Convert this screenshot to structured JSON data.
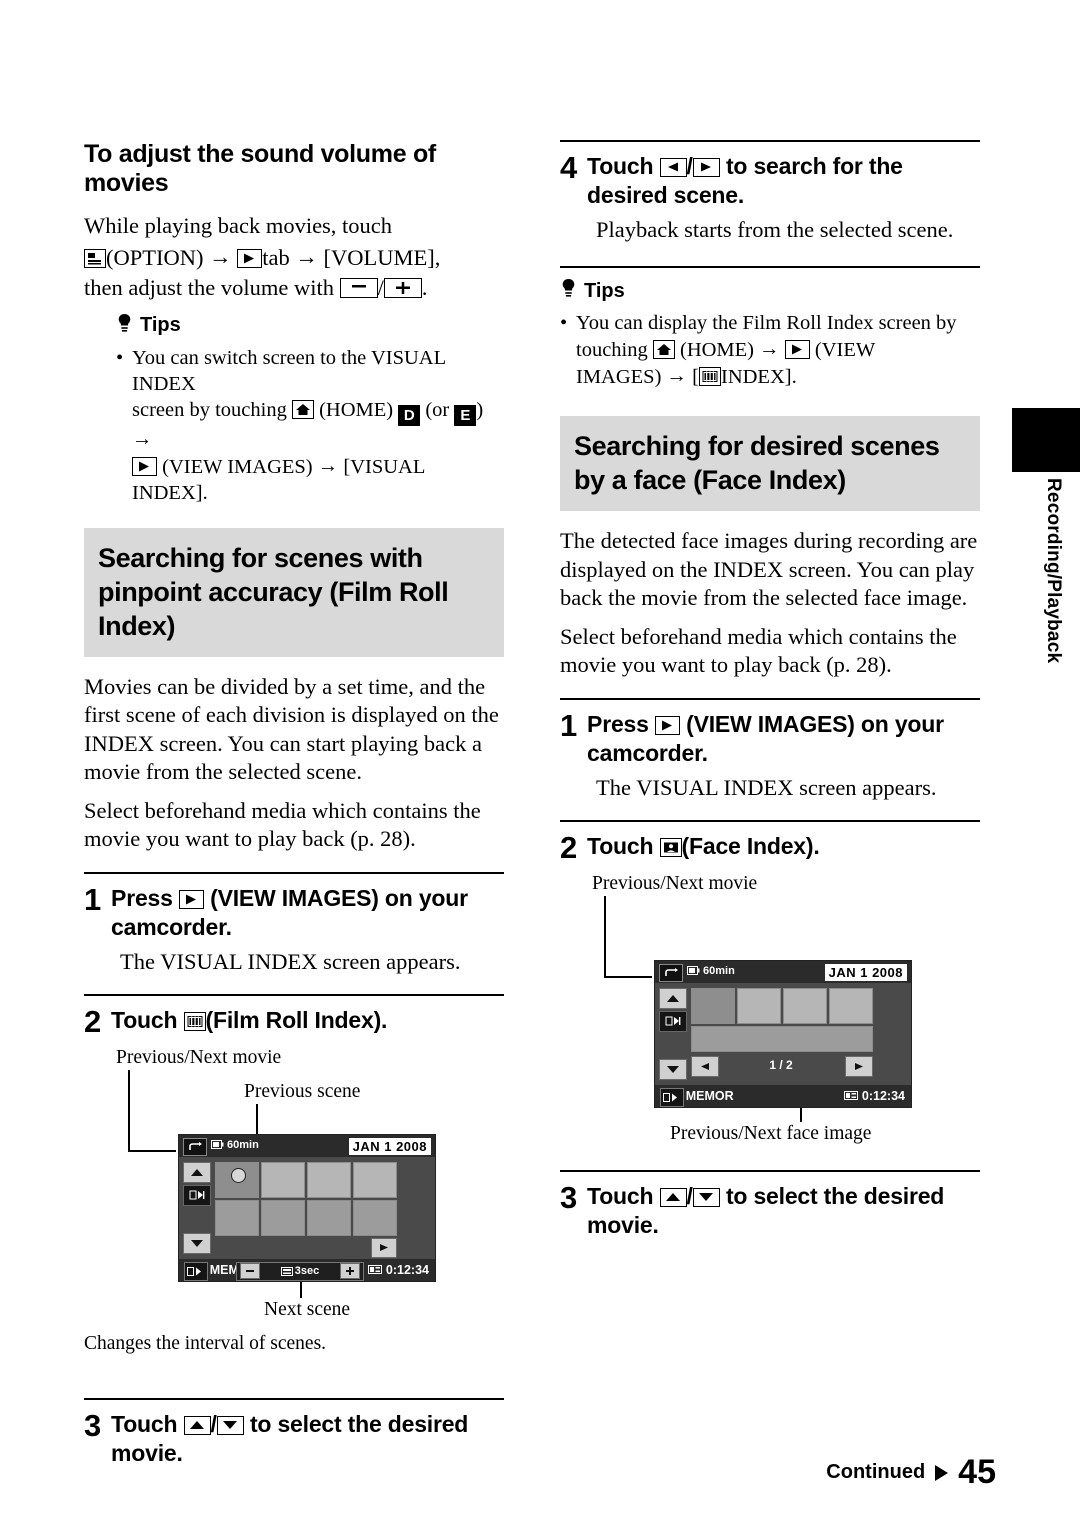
{
  "page": {
    "number": "45",
    "continued": "Continued",
    "side_tab": "Recording/Playback"
  },
  "left": {
    "volume": {
      "title": "To adjust the sound volume of movies",
      "line1": "While playing back movies, touch",
      "line2_pre": "(OPTION)",
      "line2_tab": "tab",
      "line2_volume": "[VOLUME],",
      "line3_pre": "then adjust the volume with",
      "line3_post": ".",
      "tips_label": "Tips",
      "tip1_a": "You can switch screen to the VISUAL INDEX",
      "tip1_b": "screen by touching",
      "tip1_home": "(HOME)",
      "tip1_d": "D",
      "tip1_or": "(or",
      "tip1_e": "E",
      "tip1_close": ")",
      "tip1_c": "(VIEW IMAGES)",
      "tip1_d2": "[VISUAL INDEX]."
    },
    "filmroll": {
      "heading": "Searching for scenes with pinpoint accuracy (Film Roll Index)",
      "intro": "Movies can be divided by a set time, and the first scene of each division is displayed on the INDEX screen. You can start playing back a movie from the selected scene.",
      "intro2": "Select beforehand media which contains the movie you want to play back (p. 28).",
      "step1_num": "1",
      "step1_a": "Press",
      "step1_b": "(VIEW IMAGES) on your camcorder.",
      "step1_body": "The VISUAL INDEX screen appears.",
      "step2_num": "2",
      "step2_a": "Touch",
      "step2_b": "(Film Roll Index).",
      "callout_prevnext": "Previous/Next movie",
      "callout_prevscene": "Previous scene",
      "callout_nextscene": "Next scene",
      "callout_interval": "Changes the interval of scenes.",
      "step3_num": "3",
      "step3_a": "Touch",
      "step3_b": "to select the desired movie.",
      "lcd": {
        "battery": "60min",
        "date": "JAN  1  2008",
        "memory": "INT. MEMORY",
        "timecode": "0:12:34",
        "interval": "3sec"
      }
    }
  },
  "right": {
    "step4": {
      "num": "4",
      "a": "Touch",
      "b": "to search for the desired scene.",
      "body": "Playback starts from the selected scene.",
      "tips_label": "Tips",
      "tip1_a": "You can display the Film Roll Index screen by",
      "tip1_b": "touching",
      "tip1_home": "(HOME)",
      "tip1_c": "(VIEW",
      "tip1_d": "IMAGES)",
      "tip1_e": "INDEX]."
    },
    "faceindex": {
      "heading": "Searching for desired scenes by a face (Face Index)",
      "intro": "The detected face images during recording are displayed on the INDEX screen. You can play back the movie from the selected face image.",
      "intro2": "Select beforehand media which contains the movie you want to play back (p. 28).",
      "step1_num": "1",
      "step1_a": "Press",
      "step1_b": "(VIEW IMAGES) on your camcorder.",
      "step1_body": "The VISUAL INDEX screen appears.",
      "step2_num": "2",
      "step2_a": "Touch",
      "step2_b": "(Face Index).",
      "callout_prevnext": "Previous/Next movie",
      "callout_face": "Previous/Next face image",
      "step3_num": "3",
      "step3_a": "Touch",
      "step3_b": "to select the desired movie.",
      "lcd": {
        "battery": "60min",
        "date": "JAN  1  2008",
        "memory": "INT. MEMOR",
        "timecode": "0:12:34",
        "pagecount": "1 / 2"
      }
    }
  }
}
